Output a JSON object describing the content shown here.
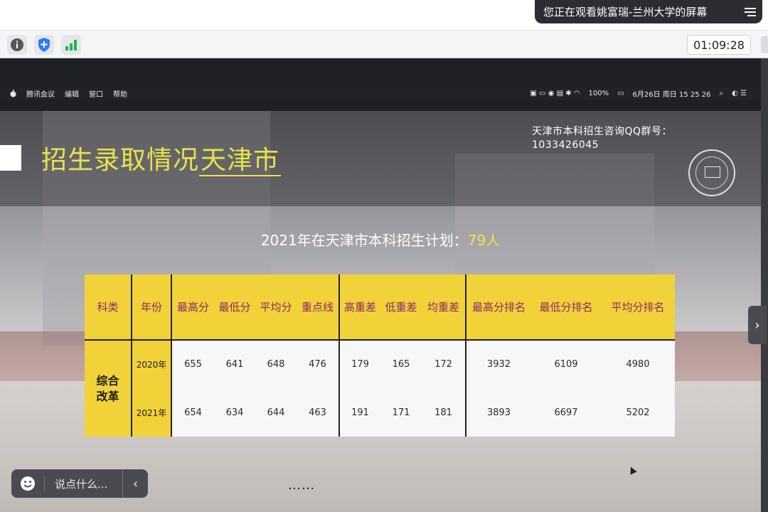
{
  "share_banner": {
    "text": "您正在观看姚富瑞-兰州大学的屏幕",
    "menu_icon": "list-icon"
  },
  "toolbar": {
    "timer": "01:09:28"
  },
  "mac_menubar": {
    "app_items": [
      "腾讯会议",
      "编辑",
      "窗口",
      "帮助"
    ],
    "battery": "100%",
    "datetime": "6月26日 周日 15 25 26"
  },
  "slide": {
    "title_prefix": "招生录取情况",
    "title_city": "天津市",
    "qq_label": "天津市本科招生咨询QQ群号：",
    "qq_number": "1033426045",
    "plan_text": "2021年在天津市本科招生计划：",
    "plan_num": "79人",
    "table": {
      "headers": [
        "科类",
        "年份",
        "最高分",
        "最低分",
        "平均分",
        "重点线",
        "高重差",
        "低重差",
        "均重差",
        "最高分排名",
        "最低分排名",
        "平均分排名"
      ],
      "category": "综合改革",
      "rows": [
        {
          "year": "2020年",
          "values": [
            "655",
            "641",
            "648",
            "476",
            "179",
            "165",
            "172",
            "3932",
            "6109",
            "4980"
          ]
        },
        {
          "year": "2021年",
          "values": [
            "654",
            "634",
            "644",
            "463",
            "191",
            "171",
            "181",
            "3893",
            "6697",
            "5202"
          ]
        }
      ]
    }
  },
  "chat": {
    "placeholder": "说点什么...",
    "dots": "……"
  },
  "colors": {
    "accent_yellow": "#f2d239",
    "title_yellow": "#e8e34a",
    "header_text": "#8a2a6a"
  }
}
